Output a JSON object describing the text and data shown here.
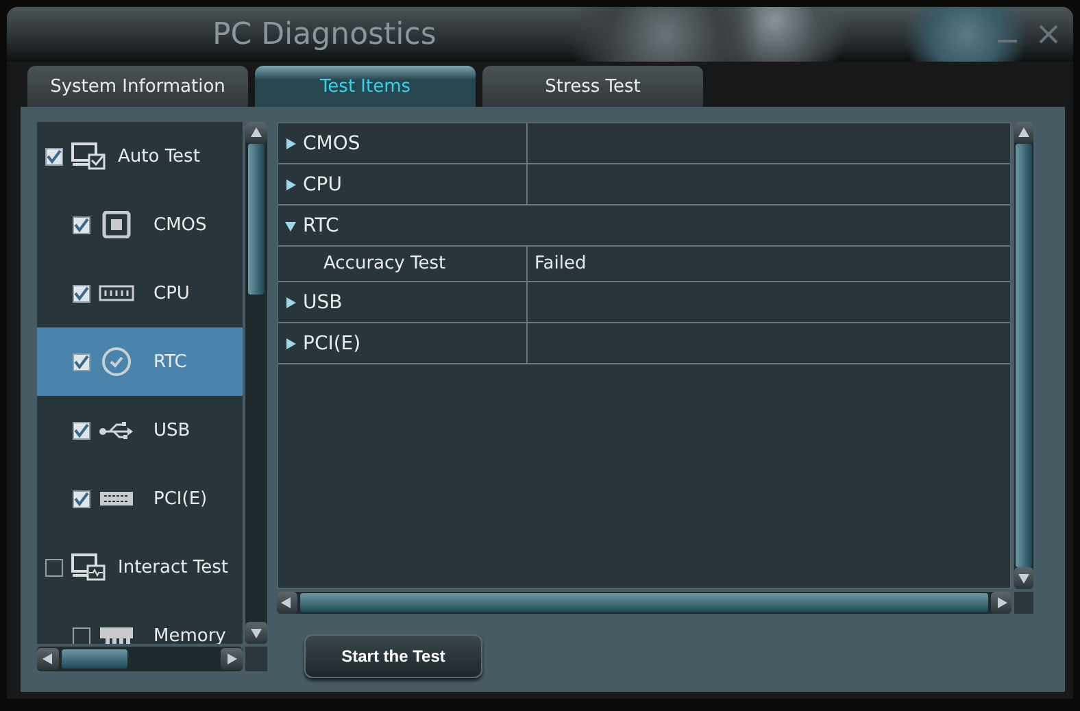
{
  "window": {
    "title": "PC Diagnostics"
  },
  "tabs": [
    {
      "label": "System Information",
      "selected": false
    },
    {
      "label": "Test Items",
      "selected": true
    },
    {
      "label": "Stress Test",
      "selected": false
    }
  ],
  "test_tree": [
    {
      "label": "Auto Test",
      "checked": true,
      "selected": false,
      "children": [
        {
          "label": "CMOS",
          "checked": true,
          "selected": false
        },
        {
          "label": "CPU",
          "checked": true,
          "selected": false
        },
        {
          "label": "RTC",
          "checked": true,
          "selected": true
        },
        {
          "label": "USB",
          "checked": true,
          "selected": false
        },
        {
          "label": "PCI(E)",
          "checked": true,
          "selected": false
        }
      ]
    },
    {
      "label": "Interact Test",
      "checked": false,
      "selected": false,
      "children": [
        {
          "label": "Memory",
          "checked": false,
          "selected": false
        }
      ]
    }
  ],
  "results": [
    {
      "label": "CMOS",
      "expanded": false
    },
    {
      "label": "CPU",
      "expanded": false
    },
    {
      "label": "RTC",
      "expanded": true,
      "children": [
        {
          "label": "Accuracy Test",
          "value": "Failed"
        }
      ]
    },
    {
      "label": "USB",
      "expanded": false
    },
    {
      "label": "PCI(E)",
      "expanded": false
    }
  ],
  "start_button": "Start the Test"
}
